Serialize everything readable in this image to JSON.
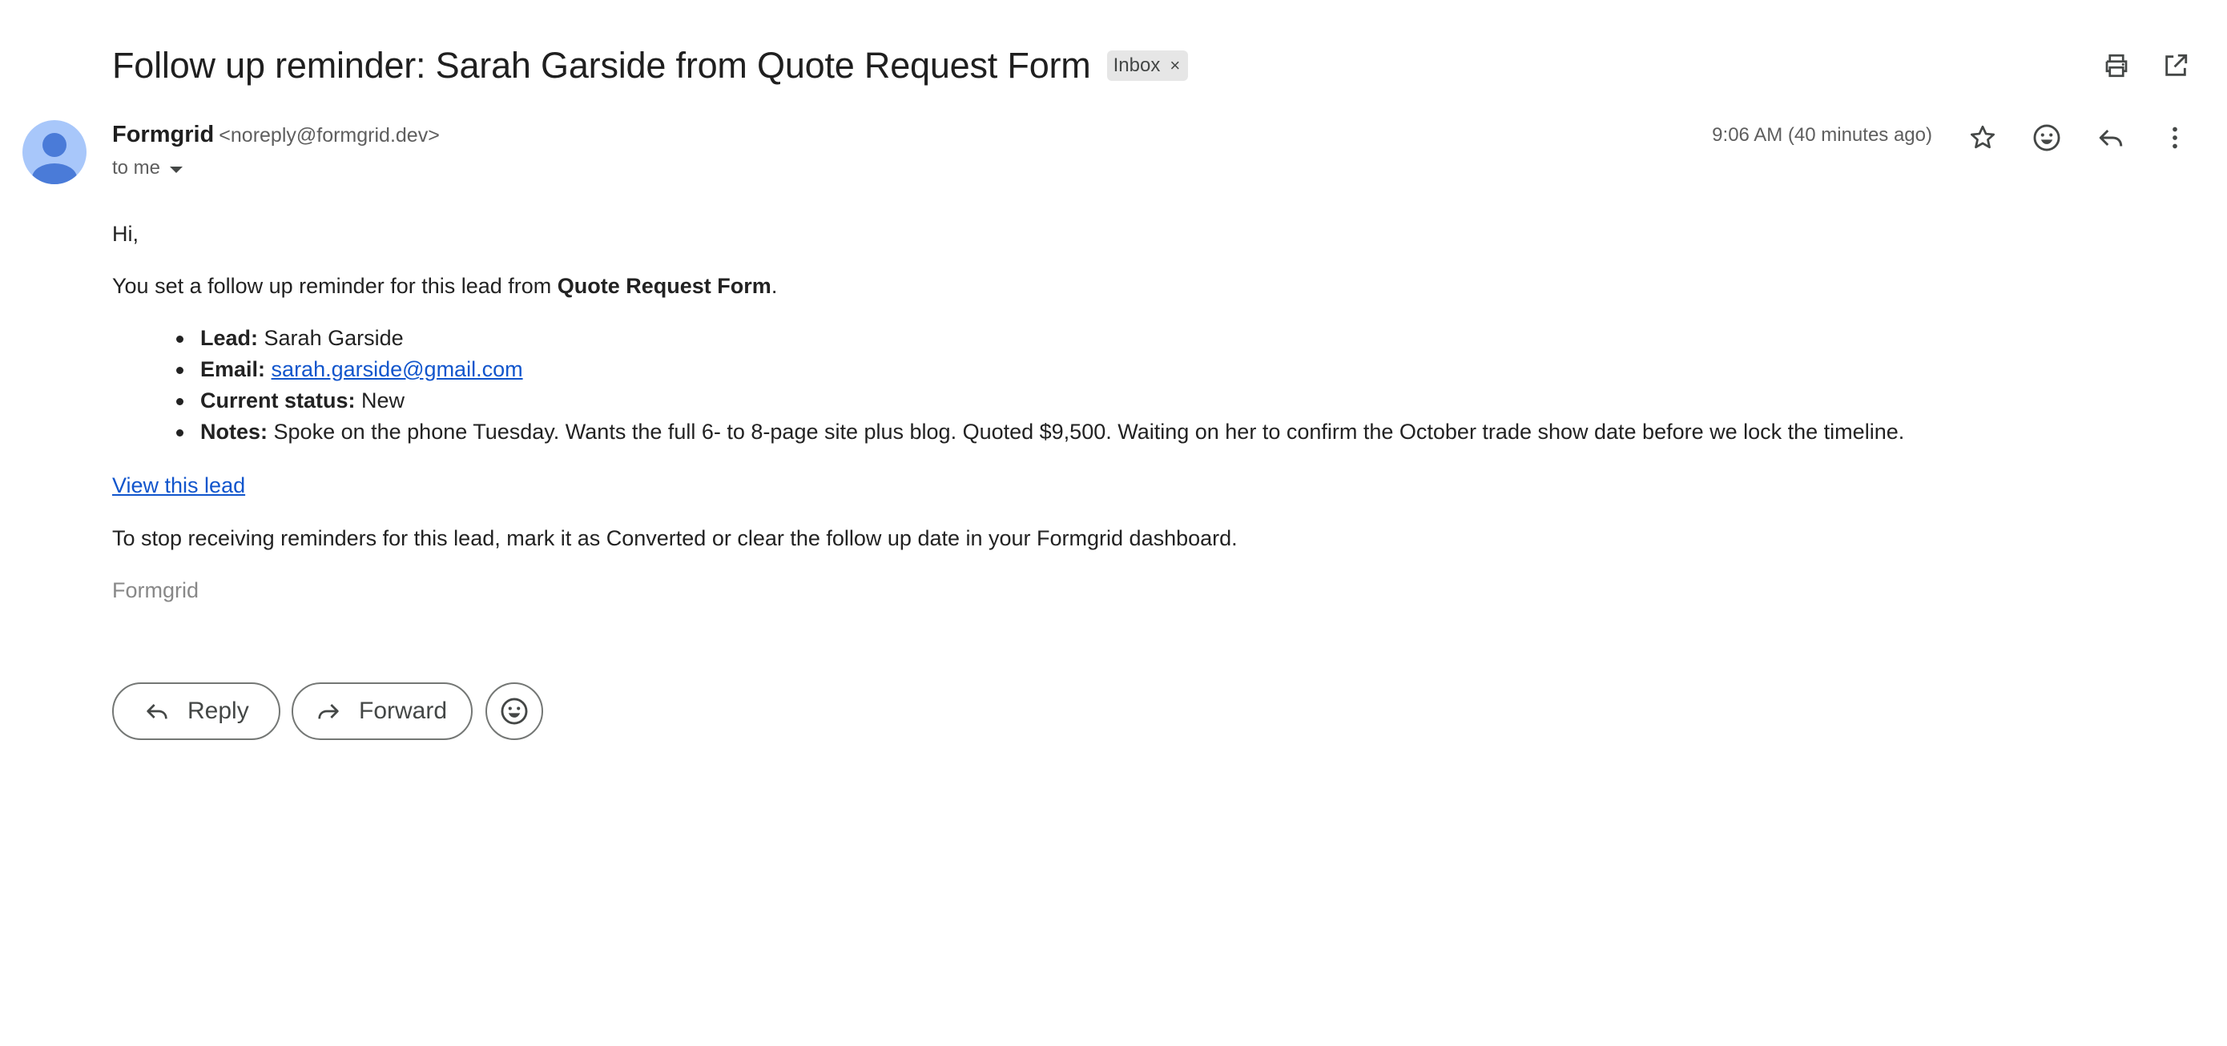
{
  "email": {
    "subject": "Follow up reminder: Sarah Garside from Quote Request Form",
    "label": "Inbox",
    "label_close": "×",
    "sender_name": "Formgrid",
    "sender_email": "<noreply@formgrid.dev>",
    "recipient": "to me",
    "timestamp": "9:06 AM (40 minutes ago)"
  },
  "body": {
    "greeting": "Hi,",
    "intro_prefix": "You set a follow up reminder for this lead from ",
    "intro_form": "Quote Request Form",
    "intro_suffix": ".",
    "fields": {
      "lead_label": "Lead:",
      "lead_value": "Sarah Garside",
      "email_label": "Email:",
      "email_value": "sarah.garside@gmail.com",
      "status_label": "Current status:",
      "status_value": "New",
      "notes_label": "Notes:",
      "notes_value": "Spoke on the phone Tuesday. Wants the full 6- to 8-page site plus blog. Quoted $9,500. Waiting on her to confirm the October trade show date before we lock the timeline."
    },
    "view_link": "View this lead",
    "stop_text": "To stop receiving reminders for this lead, mark it as Converted or clear the follow up date in your Formgrid dashboard.",
    "signature": "Formgrid"
  },
  "actions": {
    "reply_label": "Reply",
    "forward_label": "Forward"
  },
  "icons": {
    "print": "print-icon",
    "open_new_window": "open-in-new-window-icon",
    "star": "star-icon",
    "emoji": "emoji-icon",
    "reply": "reply-icon",
    "more": "more-vert-icon",
    "forward": "forward-icon",
    "avatar": "person-icon"
  },
  "colors": {
    "link": "#1155cc",
    "avatar_bg": "#a8c7fa",
    "avatar_fg": "#4a7bd8",
    "chip_bg": "#e6e6e6"
  }
}
